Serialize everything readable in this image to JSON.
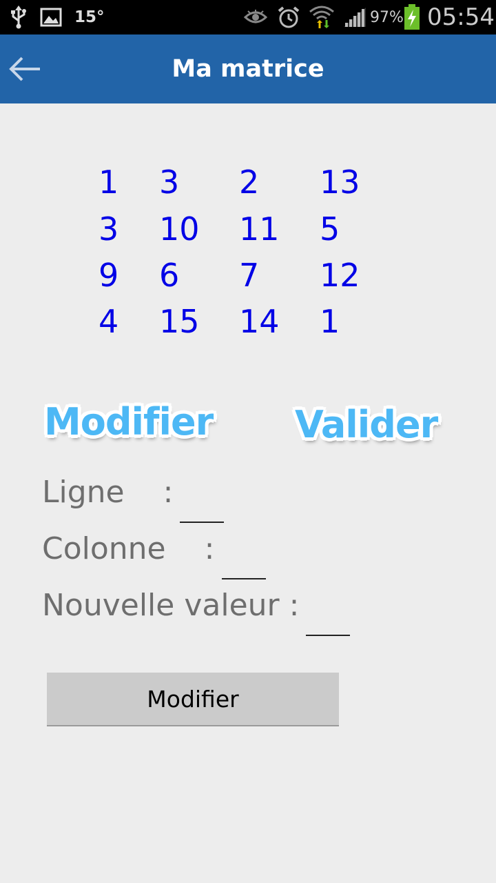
{
  "status_bar": {
    "temperature": "15°",
    "battery_percent": "97%",
    "time": "05:54",
    "icons": [
      "usb-icon",
      "image-icon",
      "eye-icon",
      "alarm-icon",
      "wifi-icon",
      "signal-icon",
      "battery-charging-icon"
    ]
  },
  "action_bar": {
    "title": "Ma matrice",
    "back_icon": "arrow-left-icon",
    "color": "#2264a8"
  },
  "matrix": {
    "rows": [
      [
        "1",
        "3",
        "2",
        "13"
      ],
      [
        "3",
        "10",
        "11",
        "5"
      ],
      [
        "9",
        "6",
        "7",
        "12"
      ],
      [
        "4",
        "15",
        "14",
        "1"
      ]
    ],
    "color": "#0000e6"
  },
  "buttons": {
    "modifier_logo": "Modifier",
    "valider_logo": "Valider",
    "modifier_button": "Modifier"
  },
  "form": {
    "ligne_label": "Ligne    :",
    "colonne_label": "Colonne    :",
    "valeur_label": "Nouvelle valeur :",
    "ligne_value": "",
    "colonne_value": "",
    "valeur_value": ""
  }
}
